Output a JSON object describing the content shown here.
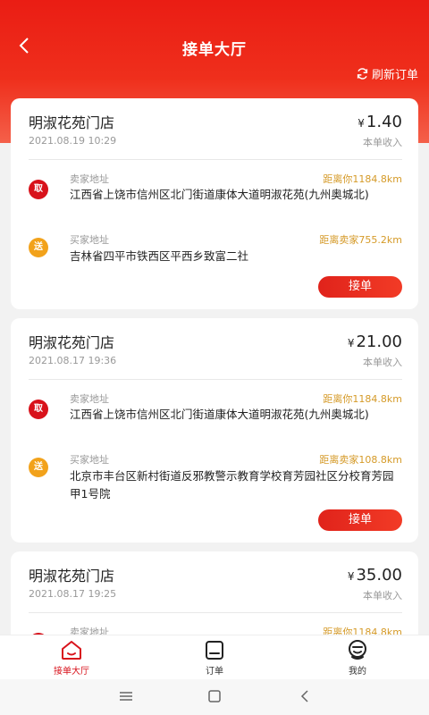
{
  "header": {
    "title": "接单大厅",
    "refresh_label": "刷新订单"
  },
  "orders": [
    {
      "shop": "明淑花苑门店",
      "time": "2021.08.19 10:29",
      "currency": "¥",
      "amount": "1.40",
      "income_label": "本单收入",
      "pickup": {
        "tag": "取",
        "label": "卖家地址",
        "distance": "距离你1184.8km",
        "address": "江西省上饶市信州区北门街道康体大道明淑花苑(九州奥城北)"
      },
      "delivery": {
        "tag": "送",
        "label": "买家地址",
        "distance": "距离卖家755.2km",
        "address": "吉林省四平市铁西区平西乡致富二社"
      },
      "accept_label": "接单"
    },
    {
      "shop": "明淑花苑门店",
      "time": "2021.08.17 19:36",
      "currency": "¥",
      "amount": "21.00",
      "income_label": "本单收入",
      "pickup": {
        "tag": "取",
        "label": "卖家地址",
        "distance": "距离你1184.8km",
        "address": "江西省上饶市信州区北门街道康体大道明淑花苑(九州奥城北)"
      },
      "delivery": {
        "tag": "送",
        "label": "买家地址",
        "distance": "距离卖家108.8km",
        "address": "北京市丰台区新村街道反邪教警示教育学校育芳园社区分校育芳园甲1号院"
      },
      "accept_label": "接单"
    },
    {
      "shop": "明淑花苑门店",
      "time": "2021.08.17 19:25",
      "currency": "¥",
      "amount": "35.00",
      "income_label": "本单收入",
      "pickup": {
        "tag": "取",
        "label": "卖家地址",
        "distance": "距离你1184.8km"
      }
    }
  ],
  "tabbar": {
    "items": [
      {
        "label": "接单大厅",
        "icon": "home-icon",
        "active": true
      },
      {
        "label": "订单",
        "icon": "order-icon",
        "active": false
      },
      {
        "label": "我的",
        "icon": "profile-icon",
        "active": false
      }
    ],
    "active_color": "#d8121b"
  },
  "theme": {
    "accent": "#ea1d14",
    "distance_color": "#d59a28",
    "delivery_tag": "#f2a21b"
  }
}
